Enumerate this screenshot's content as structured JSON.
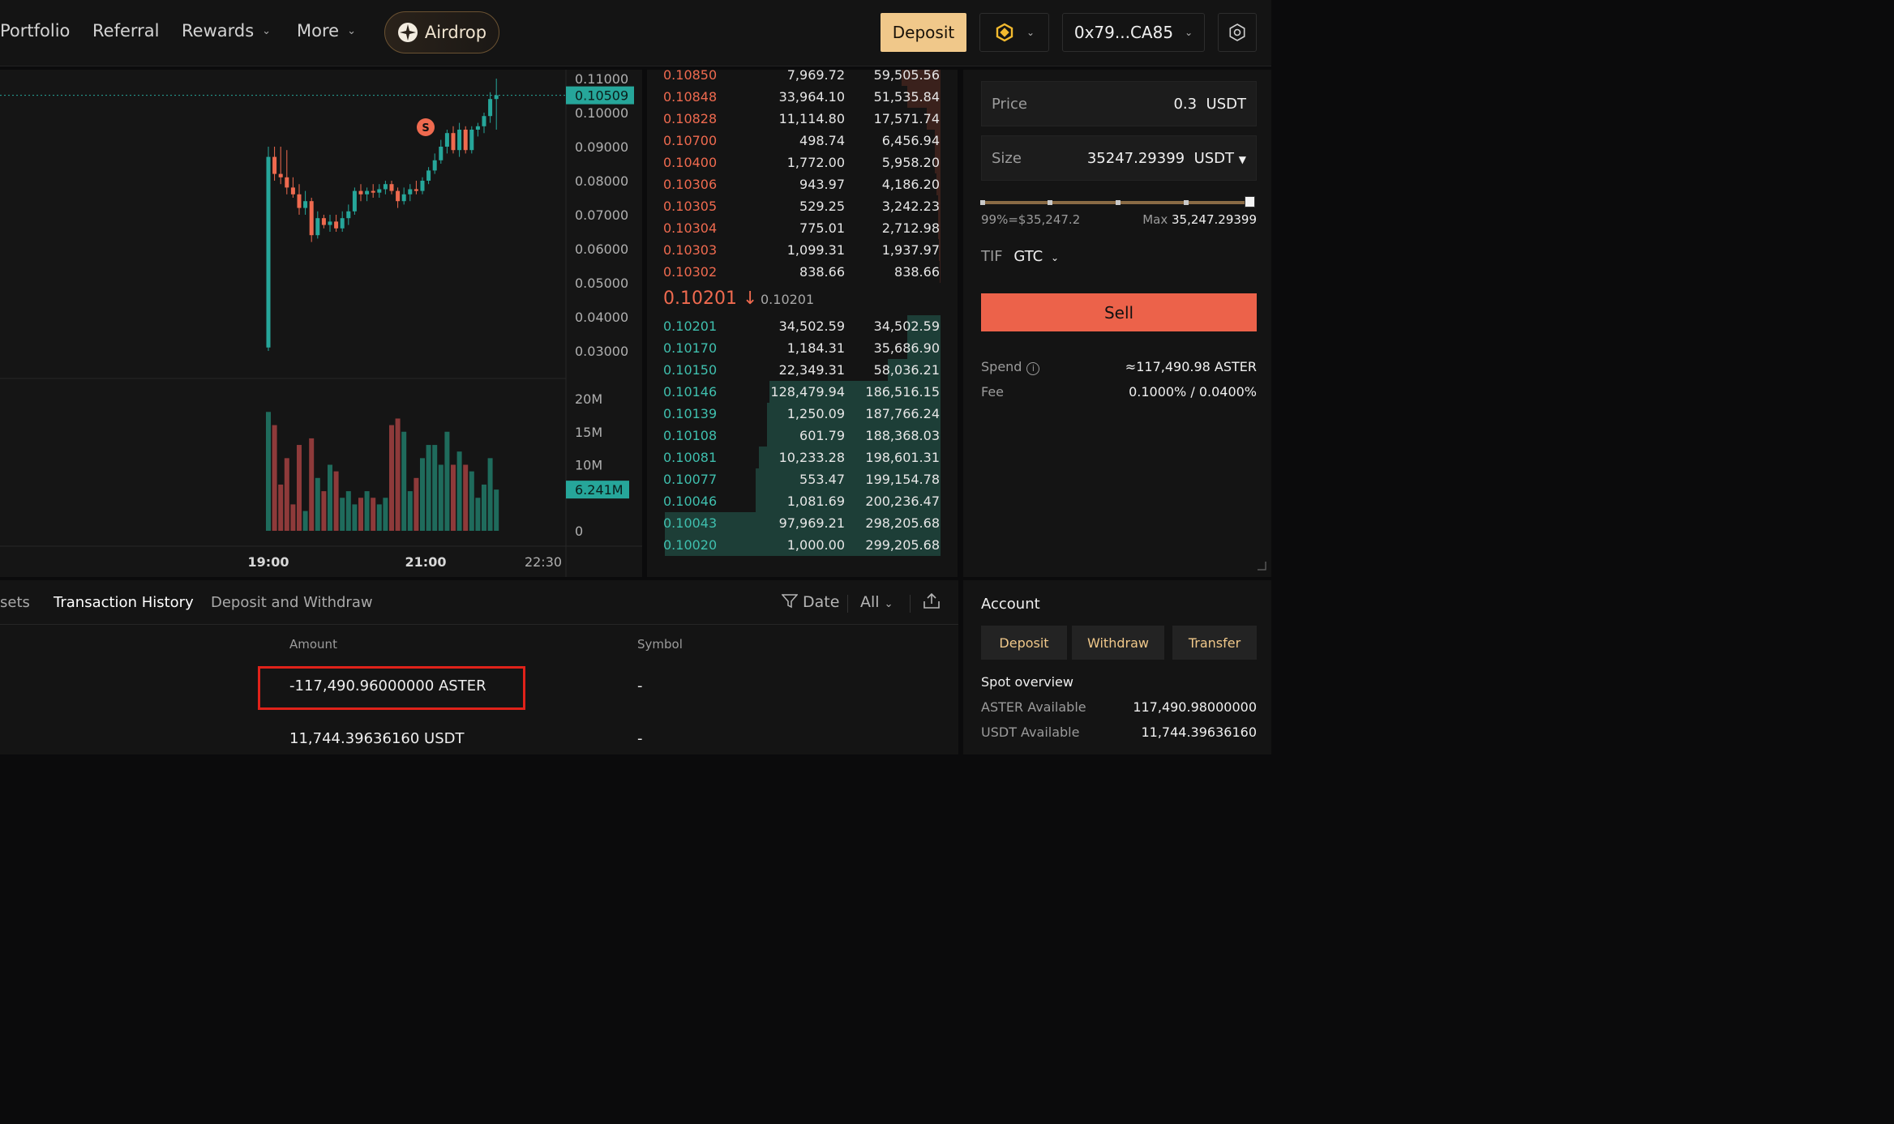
{
  "nav": {
    "items": [
      {
        "label": "Portfolio",
        "dropdown": false
      },
      {
        "label": "Referral",
        "dropdown": false
      },
      {
        "label": "Rewards",
        "dropdown": true
      },
      {
        "label": "More",
        "dropdown": true
      }
    ],
    "airdrop_label": "Airdrop",
    "deposit_label": "Deposit",
    "wallet_label": "0x79...CA85",
    "chain_icon": "bnb-chain-icon",
    "settings_icon": "settings-icon"
  },
  "colors": {
    "up": "#26a69a",
    "down": "#ef6a4f",
    "accent": "#f0c88a"
  },
  "chart": {
    "price_ticks": [
      "0.11000",
      "0.10000",
      "0.09000",
      "0.08000",
      "0.07000",
      "0.06000",
      "0.05000",
      "0.04000",
      "0.03000"
    ],
    "current_price_label": "0.10509",
    "volume_ticks": [
      "20M",
      "15M",
      "10M",
      "0"
    ],
    "volume_label": "6.241M",
    "time_ticks": [
      "19:00",
      "21:00",
      "22:30"
    ],
    "marker_label": "S"
  },
  "chart_data": {
    "type": "candlestick",
    "price_axis": {
      "min": 0.03,
      "max": 0.11
    },
    "volume_axis": {
      "min": 0,
      "max": 20000000
    },
    "x_ticks": [
      "19:00",
      "21:00",
      "22:30"
    ],
    "last_price": 0.10509,
    "last_volume": 6241000,
    "candles": [
      {
        "o": 0.031,
        "h": 0.09,
        "l": 0.03,
        "c": 0.087,
        "v": 18000000
      },
      {
        "o": 0.087,
        "h": 0.09,
        "l": 0.08,
        "c": 0.082,
        "v": 16000000
      },
      {
        "o": 0.082,
        "h": 0.09,
        "l": 0.079,
        "c": 0.081,
        "v": 7000000
      },
      {
        "o": 0.081,
        "h": 0.089,
        "l": 0.076,
        "c": 0.078,
        "v": 11000000
      },
      {
        "o": 0.078,
        "h": 0.081,
        "l": 0.075,
        "c": 0.076,
        "v": 4000000
      },
      {
        "o": 0.076,
        "h": 0.079,
        "l": 0.07,
        "c": 0.072,
        "v": 13000000
      },
      {
        "o": 0.072,
        "h": 0.077,
        "l": 0.07,
        "c": 0.074,
        "v": 3000000
      },
      {
        "o": 0.074,
        "h": 0.075,
        "l": 0.062,
        "c": 0.064,
        "v": 14000000
      },
      {
        "o": 0.064,
        "h": 0.071,
        "l": 0.063,
        "c": 0.069,
        "v": 8000000
      },
      {
        "o": 0.069,
        "h": 0.07,
        "l": 0.066,
        "c": 0.067,
        "v": 6000000
      },
      {
        "o": 0.067,
        "h": 0.07,
        "l": 0.065,
        "c": 0.068,
        "v": 10000000
      },
      {
        "o": 0.068,
        "h": 0.07,
        "l": 0.065,
        "c": 0.066,
        "v": 9000000
      },
      {
        "o": 0.066,
        "h": 0.071,
        "l": 0.065,
        "c": 0.069,
        "v": 5000000
      },
      {
        "o": 0.069,
        "h": 0.073,
        "l": 0.067,
        "c": 0.071,
        "v": 6000000
      },
      {
        "o": 0.071,
        "h": 0.078,
        "l": 0.07,
        "c": 0.077,
        "v": 4000000
      },
      {
        "o": 0.077,
        "h": 0.079,
        "l": 0.074,
        "c": 0.076,
        "v": 5000000
      },
      {
        "o": 0.076,
        "h": 0.078,
        "l": 0.074,
        "c": 0.077,
        "v": 6000000
      },
      {
        "o": 0.077,
        "h": 0.079,
        "l": 0.075,
        "c": 0.0765,
        "v": 5000000
      },
      {
        "o": 0.0765,
        "h": 0.079,
        "l": 0.075,
        "c": 0.0775,
        "v": 4000000
      },
      {
        "o": 0.0775,
        "h": 0.08,
        "l": 0.076,
        "c": 0.079,
        "v": 5000000
      },
      {
        "o": 0.079,
        "h": 0.08,
        "l": 0.076,
        "c": 0.077,
        "v": 16000000
      },
      {
        "o": 0.077,
        "h": 0.078,
        "l": 0.072,
        "c": 0.074,
        "v": 17000000
      },
      {
        "o": 0.074,
        "h": 0.078,
        "l": 0.073,
        "c": 0.076,
        "v": 15000000
      },
      {
        "o": 0.076,
        "h": 0.079,
        "l": 0.074,
        "c": 0.0775,
        "v": 6000000
      },
      {
        "o": 0.0775,
        "h": 0.08,
        "l": 0.076,
        "c": 0.077,
        "v": 8000000
      },
      {
        "o": 0.077,
        "h": 0.081,
        "l": 0.076,
        "c": 0.08,
        "v": 11000000
      },
      {
        "o": 0.08,
        "h": 0.084,
        "l": 0.079,
        "c": 0.083,
        "v": 13000000
      },
      {
        "o": 0.083,
        "h": 0.088,
        "l": 0.082,
        "c": 0.086,
        "v": 13000000
      },
      {
        "o": 0.086,
        "h": 0.092,
        "l": 0.085,
        "c": 0.09,
        "v": 10000000
      },
      {
        "o": 0.09,
        "h": 0.095,
        "l": 0.088,
        "c": 0.094,
        "v": 15000000
      },
      {
        "o": 0.094,
        "h": 0.096,
        "l": 0.088,
        "c": 0.089,
        "v": 10000000
      },
      {
        "o": 0.089,
        "h": 0.097,
        "l": 0.087,
        "c": 0.095,
        "v": 12000000
      },
      {
        "o": 0.095,
        "h": 0.096,
        "l": 0.088,
        "c": 0.089,
        "v": 10000000
      },
      {
        "o": 0.089,
        "h": 0.096,
        "l": 0.088,
        "c": 0.095,
        "v": 9000000
      },
      {
        "o": 0.095,
        "h": 0.097,
        "l": 0.093,
        "c": 0.096,
        "v": 5000000
      },
      {
        "o": 0.096,
        "h": 0.1,
        "l": 0.094,
        "c": 0.099,
        "v": 7000000
      },
      {
        "o": 0.099,
        "h": 0.106,
        "l": 0.097,
        "c": 0.104,
        "v": 11000000
      },
      {
        "o": 0.104,
        "h": 0.11,
        "l": 0.095,
        "c": 0.1051,
        "v": 6241000
      }
    ]
  },
  "orderbook": {
    "asks": [
      {
        "price": "0.10850",
        "size": "7,969.72",
        "total": "59,505.56",
        "depth": 0.14
      },
      {
        "price": "0.10848",
        "size": "33,964.10",
        "total": "51,535.84",
        "depth": 0.12
      },
      {
        "price": "0.10828",
        "size": "11,114.80",
        "total": "17,571.74",
        "depth": 0.05
      },
      {
        "price": "0.10700",
        "size": "498.74",
        "total": "6,456.94",
        "depth": 0.02
      },
      {
        "price": "0.10400",
        "size": "1,772.00",
        "total": "5,958.20",
        "depth": 0.02
      },
      {
        "price": "0.10306",
        "size": "943.97",
        "total": "4,186.20",
        "depth": 0.015
      },
      {
        "price": "0.10305",
        "size": "529.25",
        "total": "3,242.23",
        "depth": 0.01
      },
      {
        "price": "0.10304",
        "size": "775.01",
        "total": "2,712.98",
        "depth": 0.01
      },
      {
        "price": "0.10303",
        "size": "1,099.31",
        "total": "1,937.97",
        "depth": 0.006
      },
      {
        "price": "0.10302",
        "size": "838.66",
        "total": "838.66",
        "depth": 0.003
      }
    ],
    "mid_price": "0.10201",
    "mid_arrow": "↓",
    "mid_ref": "0.10201",
    "bids": [
      {
        "price": "0.10201",
        "size": "34,502.59",
        "total": "34,502.59",
        "depth": 0.12
      },
      {
        "price": "0.10170",
        "size": "1,184.31",
        "total": "35,686.90",
        "depth": 0.12
      },
      {
        "price": "0.10150",
        "size": "22,349.31",
        "total": "58,036.21",
        "depth": 0.19
      },
      {
        "price": "0.10146",
        "size": "128,479.94",
        "total": "186,516.15",
        "depth": 0.62
      },
      {
        "price": "0.10139",
        "size": "1,250.09",
        "total": "187,766.24",
        "depth": 0.63
      },
      {
        "price": "0.10108",
        "size": "601.79",
        "total": "188,368.03",
        "depth": 0.63
      },
      {
        "price": "0.10081",
        "size": "10,233.28",
        "total": "198,601.31",
        "depth": 0.66
      },
      {
        "price": "0.10077",
        "size": "553.47",
        "total": "199,154.78",
        "depth": 0.67
      },
      {
        "price": "0.10046",
        "size": "1,081.69",
        "total": "200,236.47",
        "depth": 0.67
      },
      {
        "price": "0.10043",
        "size": "97,969.21",
        "total": "298,205.68",
        "depth": 1.0
      },
      {
        "price": "0.10020",
        "size": "1,000.00",
        "total": "299,205.68",
        "depth": 1.0
      }
    ]
  },
  "trade": {
    "price_label": "Price",
    "price_value": "0.3",
    "price_unit": "USDT",
    "size_label": "Size",
    "size_value": "35247.29399",
    "size_unit": "USDT",
    "slider_fraction": 0.99,
    "pct_text": "99%=$35,247.2",
    "max_label": "Max",
    "max_value": "35,247.29399",
    "tif_label": "TIF",
    "tif_value": "GTC",
    "sell_label": "Sell",
    "spend_label": "Spend",
    "spend_value": "≈117,490.98 ASTER",
    "fee_label": "Fee",
    "fee_value": "0.1000% / 0.0400%"
  },
  "history": {
    "tabs": [
      "sets",
      "Transaction History",
      "Deposit and Withdraw"
    ],
    "active_tab": 1,
    "date_label": "Date",
    "filter_label": "All",
    "columns": [
      "Amount",
      "Symbol"
    ],
    "rows": [
      {
        "amount": "-117,490.96000000 ASTER",
        "symbol": "-"
      },
      {
        "amount": "11,744.39636160 USDT",
        "symbol": "-"
      }
    ]
  },
  "account": {
    "title": "Account",
    "buttons": [
      "Deposit",
      "Withdraw",
      "Transfer"
    ],
    "spot_overview": "Spot overview",
    "balances": [
      {
        "label": "ASTER Available",
        "value": "117,490.98000000"
      },
      {
        "label": "USDT Available",
        "value": "11,744.39636160"
      }
    ]
  }
}
